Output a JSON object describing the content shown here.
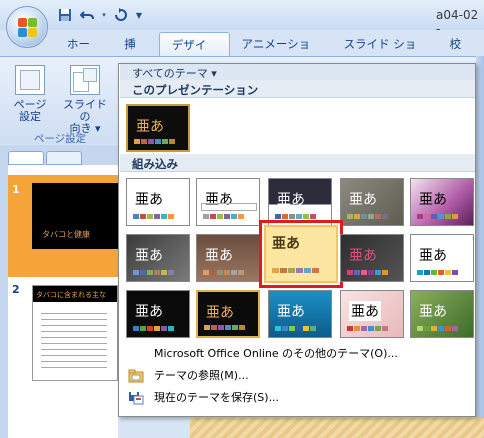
{
  "window": {
    "title": "a04-02 -"
  },
  "quick_access": {
    "save_icon": "save-icon",
    "undo_icon": "undo-icon",
    "redo_icon": "redo-icon",
    "customize_glyph": "▼"
  },
  "tabs": [
    {
      "label": "ホーム"
    },
    {
      "label": "挿入"
    },
    {
      "label": "デザイン",
      "active": true
    },
    {
      "label": "アニメーション"
    },
    {
      "label": "スライド ショー"
    },
    {
      "label": "校閲"
    }
  ],
  "ribbon": {
    "page_setup_label": "ページ\n設定",
    "page_setup_line1": "ページ",
    "page_setup_line2": "設定",
    "orientation_line1": "スライドの",
    "orientation_line2": "向き ▾",
    "group_label": "ページ設定"
  },
  "slides_pane": {
    "slide1_number": "1",
    "slide1_title": "タバコと健康",
    "slide2_number": "2",
    "slide2_title": "タバコに含まれる主な"
  },
  "dropdown": {
    "all_themes_label": "すべてのテーマ ▾",
    "this_presentation_header": "このプレゼンテーション",
    "builtin_header": "組み込み",
    "thumb_text": "亜あ",
    "menu": {
      "more_themes": "Microsoft Office Online のその他のテーマ(O)...",
      "browse_themes": "テーマの参照(M)...",
      "save_theme": "現在のテーマを保存(S)..."
    }
  },
  "colors": {
    "accent_red": "#e01b1b",
    "selection_gold": "#f7c35a",
    "ribbon_blue": "#15428b"
  }
}
